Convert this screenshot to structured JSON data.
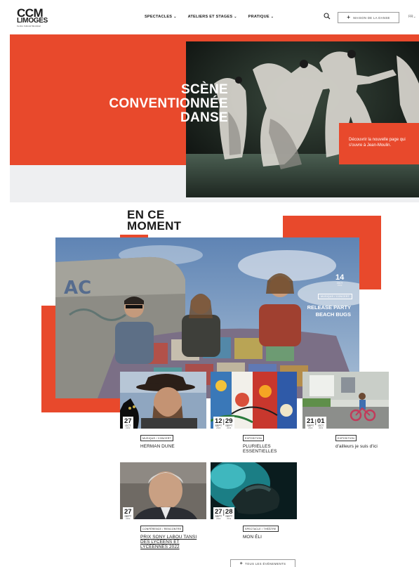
{
  "header": {
    "logo": {
      "main": "CCM",
      "sub": "LIMOGES",
      "tagline": "Centre Culturel Municipal"
    },
    "nav": [
      {
        "label": "SPECTACLES"
      },
      {
        "label": "ATELIERS ET STAGES"
      },
      {
        "label": "PRATIQUE"
      }
    ],
    "maison_button": "MAISON DE LA DANSE",
    "language": "FR"
  },
  "hero": {
    "title_lines": [
      "SCÈNE",
      "CONVENTIONNÉE",
      "DANSE"
    ],
    "card_text": "Découvrir la nouvelle page qui s'ouvre à Jean-Moulin."
  },
  "section": {
    "title_lines": [
      "EN CE",
      "MOMENT"
    ]
  },
  "feature": {
    "day": "14",
    "month": "OCT",
    "year": "2022",
    "category": "MUSIQUE / CONCERT",
    "title_lines": [
      "RELEASE PARTY",
      "BEACH BUGS"
    ]
  },
  "events": [
    {
      "day": "27",
      "month": "OCT",
      "year": "2022",
      "category": "MUSIQUE / CONCERT",
      "title": "HERMAN DUNE"
    },
    {
      "day": "12",
      "month": "SEPT",
      "year": "2022",
      "day2": "29",
      "month2": "SEPT",
      "year2": "2022",
      "category": "EXPOSITION",
      "title_lines": [
        "PLURIELLES",
        "ESSENTIELLES"
      ]
    },
    {
      "day": "21",
      "month": "SEPT",
      "year": "2022",
      "day2": "01",
      "month2": "OCT",
      "year2": "2022",
      "category": "EXPOSITION",
      "title": "d'ailleurs je suis d'ici"
    },
    {
      "day": "27",
      "month": "SEPT",
      "year": "2022",
      "category": "CONFÉRENCE / RENCONTRE",
      "title_lines": [
        "PRIX SONY LABOU TANSI",
        "DES LYCÉENS ET",
        "LYCÉENNES 2022"
      ]
    },
    {
      "day": "27",
      "month": "SEPT",
      "year": "2022",
      "day2": "28",
      "month2": "SEPT",
      "year2": "2022",
      "category": "SPECTACLE / THÉÂTRE",
      "title": "MON ÉLI"
    }
  ],
  "all_events_button": "TOUS LES ÉVÉNEMENTS",
  "colors": {
    "accent": "#e8492c",
    "text": "#1a1a1a",
    "background": "#ffffff"
  }
}
